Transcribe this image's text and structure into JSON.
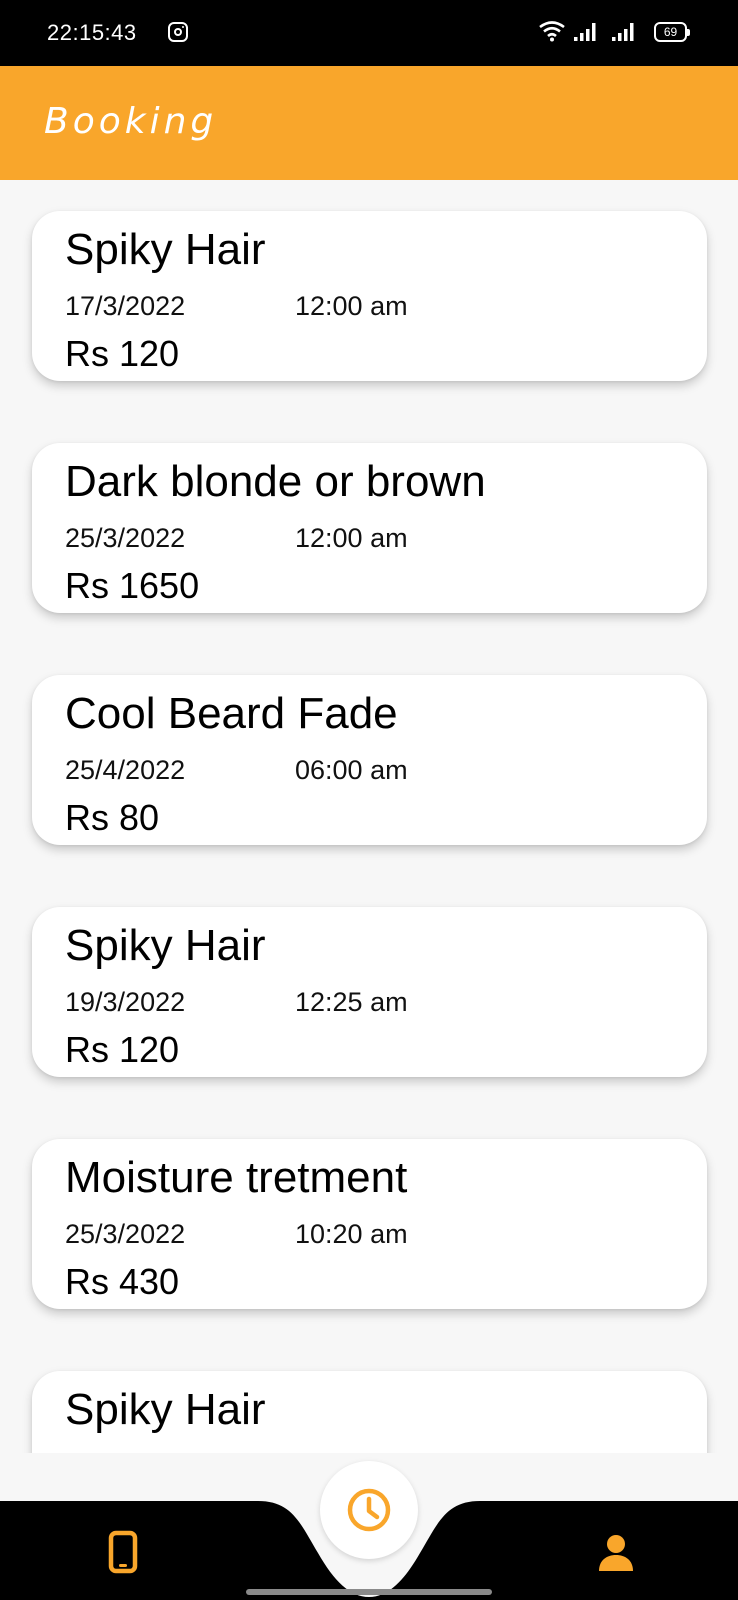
{
  "status_bar": {
    "time": "22:15:43",
    "battery": "69"
  },
  "app_bar": {
    "title": "Booking"
  },
  "bookings": [
    {
      "service": "Spiky Hair",
      "date": "17/3/2022",
      "time": "12:00 am",
      "price": "Rs 120"
    },
    {
      "service": "Dark blonde or brown",
      "date": "25/3/2022",
      "time": "12:00 am",
      "price": "Rs 1650"
    },
    {
      "service": "Cool Beard Fade",
      "date": "25/4/2022",
      "time": "06:00 am",
      "price": "Rs 80"
    },
    {
      "service": "Spiky Hair",
      "date": "19/3/2022",
      "time": "12:25 am",
      "price": "Rs 120"
    },
    {
      "service": "Moisture tretment",
      "date": "25/3/2022",
      "time": "10:20 am",
      "price": "Rs 430"
    },
    {
      "service": "Spiky Hair",
      "date": "",
      "time": "",
      "price": ""
    }
  ],
  "bottom_nav": {
    "left_icon": "phone-icon",
    "center_icon": "clock-icon",
    "right_icon": "person-icon",
    "accent": "#f9a62b"
  },
  "colors": {
    "app_bar": "#f9a62b",
    "background": "#f7f7f7",
    "card": "#ffffff",
    "nav": "#000000"
  }
}
